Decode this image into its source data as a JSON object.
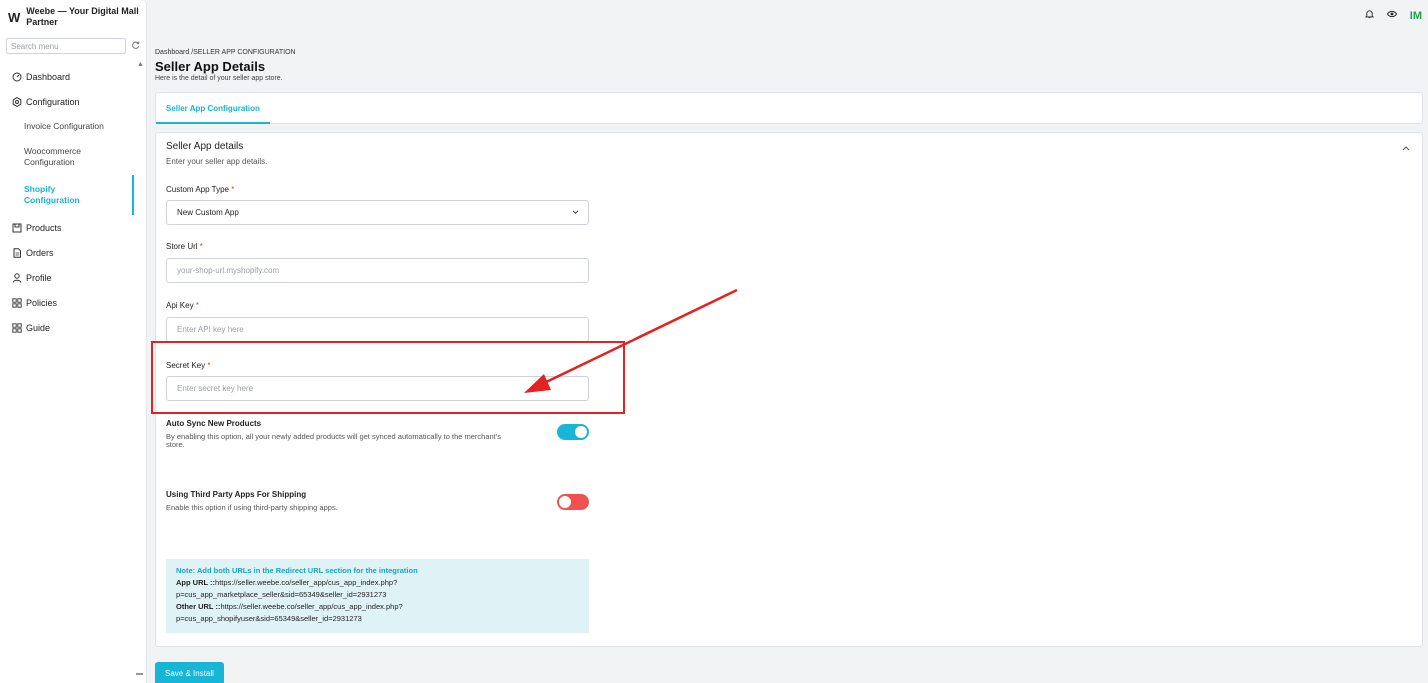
{
  "sidebar": {
    "logo": "W",
    "brand": "Weebe — Your Digital Mall Partner",
    "search_placeholder": "Search menu",
    "items": [
      {
        "label": "Dashboard"
      },
      {
        "label": "Configuration"
      },
      {
        "label": "Products"
      },
      {
        "label": "Orders"
      },
      {
        "label": "Profile"
      },
      {
        "label": "Policies"
      },
      {
        "label": "Guide"
      }
    ],
    "sub_items": [
      {
        "label": "Invoice Configuration"
      },
      {
        "label": "Woocommerce Configuration"
      },
      {
        "label": "Shopify Configuration"
      }
    ]
  },
  "topbar": {
    "avatar": "IM"
  },
  "header": {
    "breadcrumb": "Dashboard /SELLER APP CONFIGURATION",
    "title": "Seller App Details",
    "subtitle": "Here is the detail of your seller app store."
  },
  "tabs": [
    {
      "label": "Seller App Configuration"
    }
  ],
  "form": {
    "section_title": "Seller App details",
    "section_subtitle": "Enter your seller app details.",
    "app_type": {
      "label": "Custom App Type",
      "value": "New Custom App"
    },
    "store_url": {
      "label": "Store Url",
      "placeholder": "your-shop-url.myshopify.com"
    },
    "api_key": {
      "label": "Api Key",
      "placeholder": "Enter API key here"
    },
    "secret_key": {
      "label": "Secret Key",
      "placeholder": "Enter secret key here"
    },
    "required_mark": "*",
    "auto_sync": {
      "title": "Auto Sync New Products",
      "desc": "By enabling this option, all your newly added products will get synced automatically to the merchant's store.",
      "enabled": true
    },
    "third_party": {
      "title": "Using Third Party Apps For Shipping",
      "desc": "Enable this option if using third-party shipping apps.",
      "enabled": false
    },
    "note": {
      "title": "Note: Add both URLs in the Redirect URL section for the integration",
      "app_url_label": "App URL ::",
      "app_url_line1": "https://seller.weebe.co/seller_app/cus_app_index.php?",
      "app_url_line2": "p=cus_app_marketplace_seller&sid=65349&seller_id=2931273",
      "other_url_label": "Other URL ::",
      "other_url_line1": "https://seller.weebe.co/seller_app/cus_app_index.php?",
      "other_url_line2": "p=cus_app_shopifyuser&sid=65349&seller_id=2931273"
    },
    "save_label": "Save & Install"
  },
  "colors": {
    "accent": "#17b5d6",
    "danger": "#ef5350",
    "annotation": "#e32222"
  }
}
